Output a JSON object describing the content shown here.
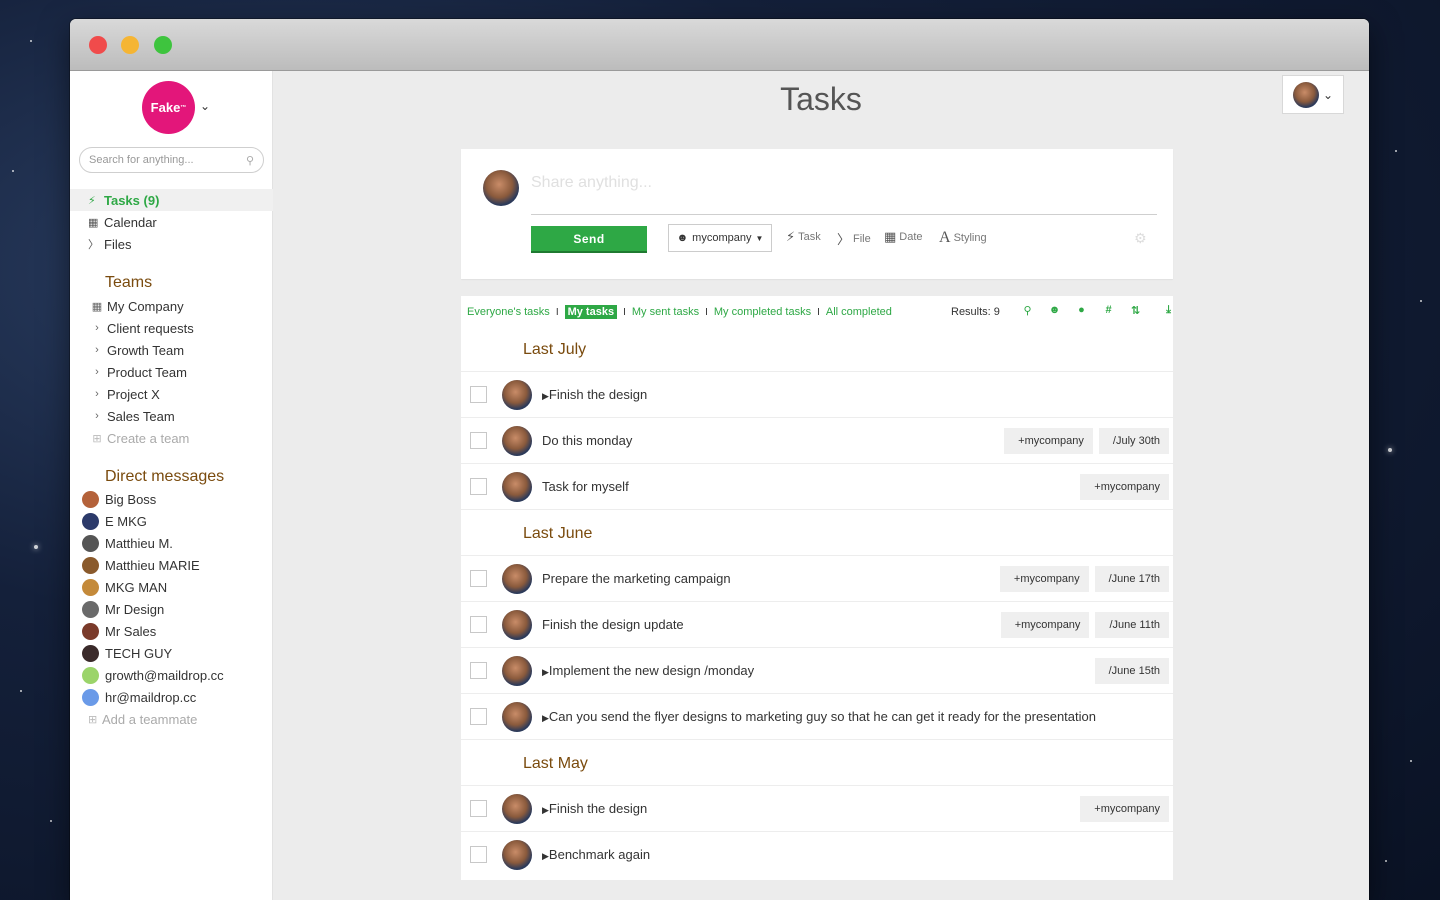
{
  "app": {
    "logo_text": "Fake",
    "logo_mark": "™",
    "search_placeholder": "Search for anything..."
  },
  "nav": [
    {
      "icon": "bolt-icon",
      "label": "Tasks (9)",
      "active": true
    },
    {
      "icon": "calendar-icon",
      "label": "Calendar",
      "active": false
    },
    {
      "icon": "paperclip-icon",
      "label": "Files",
      "active": false
    }
  ],
  "teams": {
    "title": "Teams",
    "items": [
      {
        "icon": "building-icon",
        "label": "My Company"
      },
      {
        "icon": "chevron-right-icon",
        "label": "Client requests"
      },
      {
        "icon": "chevron-right-icon",
        "label": "Growth Team"
      },
      {
        "icon": "chevron-right-icon",
        "label": "Product Team"
      },
      {
        "icon": "chevron-right-icon",
        "label": "Project X"
      },
      {
        "icon": "chevron-right-icon",
        "label": "Sales Team"
      }
    ],
    "create_label": "Create a team"
  },
  "direct_messages": {
    "title": "Direct messages",
    "items": [
      {
        "label": "Big Boss",
        "color": "#b4623a"
      },
      {
        "label": "E MKG",
        "color": "#2c3a6a"
      },
      {
        "label": "Matthieu M.",
        "color": "#555555"
      },
      {
        "label": "Matthieu MARIE",
        "color": "#8a5a2c"
      },
      {
        "label": "MKG MAN",
        "color": "#c48a3a"
      },
      {
        "label": "Mr Design",
        "color": "#6a6a6a"
      },
      {
        "label": "Mr Sales",
        "color": "#7a3a2a"
      },
      {
        "label": "TECH GUY",
        "color": "#3a2a2a"
      },
      {
        "label": "growth@maildrop.cc",
        "color": "#9bd46a"
      },
      {
        "label": "hr@maildrop.cc",
        "color": "#6a9ae8"
      }
    ],
    "add_label": "Add a teammate"
  },
  "main": {
    "title": "Tasks"
  },
  "composer": {
    "placeholder": "Share anything...",
    "send_label": "Send",
    "company_label": "mycompany",
    "tools": {
      "task": "Task",
      "file": "File",
      "date": "Date",
      "styling": "Styling"
    }
  },
  "filters": {
    "everyone": "Everyone's tasks",
    "mine": "My tasks",
    "sent": "My sent tasks",
    "completed": "My completed tasks",
    "all_completed": "All completed",
    "separator": "I",
    "results": "Results: 9"
  },
  "groups": [
    {
      "title": "Last July"
    },
    {
      "title": "Last June"
    },
    {
      "title": "Last May"
    }
  ],
  "tasks": [
    {
      "text": "Finish the design",
      "caret": true,
      "tags": []
    },
    {
      "text": "Do this monday",
      "caret": false,
      "tags": [
        "+mycompany",
        "/July 30th"
      ]
    },
    {
      "text": "Task for myself",
      "caret": false,
      "tags": [
        "+mycompany"
      ]
    },
    {
      "text": "Prepare the marketing campaign",
      "caret": false,
      "tags": [
        "+mycompany",
        "/June 17th"
      ]
    },
    {
      "text": "Finish the design update",
      "caret": false,
      "tags": [
        "+mycompany",
        "/June 11th"
      ]
    },
    {
      "text": "Implement the new design /monday",
      "caret": true,
      "tags": [
        "/June 15th"
      ]
    },
    {
      "text": "Can you send the flyer designs to marketing guy so that he can get it ready for the presentation",
      "caret": true,
      "tags": []
    },
    {
      "text": "Finish the design",
      "caret": true,
      "tags": [
        "+mycompany"
      ]
    },
    {
      "text": "Benchmark again",
      "caret": true,
      "tags": []
    }
  ],
  "colors": {
    "accent": "#2ea845",
    "brand": "#e3167a",
    "heading": "#7a4b0e"
  }
}
